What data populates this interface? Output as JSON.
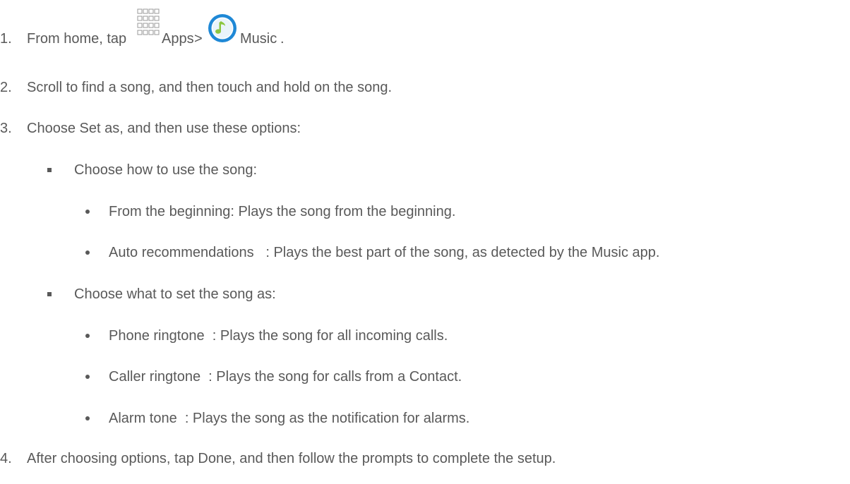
{
  "steps": [
    {
      "number": "1.",
      "prefix": "From home, tap",
      "apps_label": "Apps",
      "separator": ">",
      "music_label": "Music",
      "suffix": "."
    },
    {
      "number": "2.",
      "text": "Scroll to find a song, and then touch and hold on the song."
    },
    {
      "number": "3.",
      "text": "Choose Set as, and then use these options:",
      "options": [
        {
          "text": "Choose how to use the song:",
          "items": [
            "From the beginning: Plays the song from the beginning.",
            "Auto recommendations   : Plays the best part of the song, as detected by the Music app."
          ]
        },
        {
          "text": "Choose what to set the song as:",
          "items": [
            "Phone ringtone  : Plays the song for all incoming calls.",
            "Caller ringtone  : Plays the song for calls from a Contact.",
            "Alarm tone  : Plays the song as the notification for alarms."
          ]
        }
      ]
    },
    {
      "number": "4.",
      "text": "After choosing options, tap Done, and then follow the prompts to complete the setup."
    }
  ],
  "icons": {
    "apps": "apps-grid-icon",
    "music": "music-note-icon"
  },
  "colors": {
    "text": "#595959",
    "music_icon_blue": "#1e88d6",
    "music_note": "#8cc63f"
  }
}
